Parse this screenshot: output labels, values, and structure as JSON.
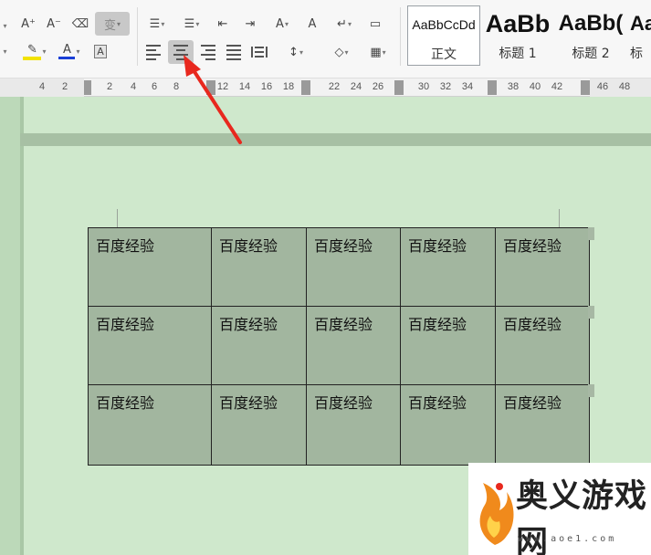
{
  "toolbar": {
    "font_grow": "A⁺",
    "font_shrink": "A⁻",
    "eraser": "⌫",
    "phonetic": "变",
    "highlight": "✎",
    "font_color": "A",
    "char_shading": "A",
    "bullets": "☰",
    "numbering": "☰",
    "outdent": "⇤",
    "indent": "⇥",
    "chinese_layout": "A",
    "text_direction": "A",
    "show_marks": "↵",
    "tab_ruler": "▭",
    "line_spacing": "↕",
    "shading": "◇",
    "borders": "▦"
  },
  "styles": {
    "normal_preview": "AaBbCcDd",
    "normal_label": "正文",
    "heading1_preview": "AaBb",
    "heading1_label": "标题 1",
    "heading2_preview": "AaBb(",
    "heading2_label": "标题 2",
    "heading3_preview": "Aa",
    "heading3_label": "标"
  },
  "ruler": {
    "ticks": [
      "4",
      "2",
      "2",
      "4",
      "6",
      "8",
      "12",
      "14",
      "16",
      "18",
      "22",
      "24",
      "26",
      "30",
      "32",
      "34",
      "38",
      "40",
      "42",
      "46",
      "48"
    ]
  },
  "table": {
    "rows": [
      [
        "百度经验",
        "百度经验",
        "百度经验",
        "百度经验",
        "百度经验"
      ],
      [
        "百度经验",
        "百度经验",
        "百度经验",
        "百度经验",
        "百度经验"
      ],
      [
        "百度经验",
        "百度经验",
        "百度经验",
        "百度经验",
        "百度经验"
      ]
    ]
  },
  "watermark": {
    "title": "奥义游戏网",
    "url": "www.aoe1.com"
  },
  "colors": {
    "doc_background": "#cfe8cc",
    "table_fill": "#a2b69f",
    "arrow": "#e8281e",
    "font_color_bar": "#1a3fd6",
    "highlight_bar": "#f2e200"
  }
}
